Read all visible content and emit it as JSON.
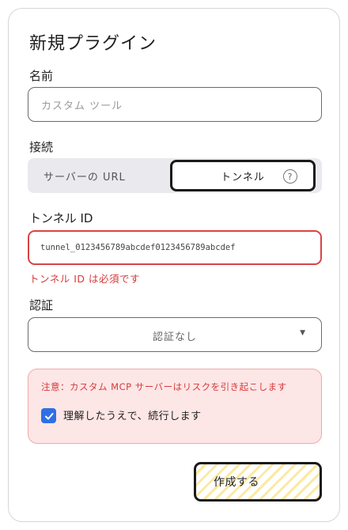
{
  "dialog": {
    "title": "新規プラグイン"
  },
  "name_field": {
    "label": "名前",
    "placeholder": "カスタム ツール"
  },
  "connection": {
    "label": "接続",
    "options": [
      "サーバーの URL",
      "トンネル"
    ],
    "selected": "トンネル",
    "help_icon": "question-circle-icon"
  },
  "tunnel_id": {
    "label": "トンネル ID",
    "value": "tunnel_0123456789abcdef0123456789abcdef",
    "error": "トンネル ID は必須です"
  },
  "auth": {
    "label": "認証",
    "value": "認証なし",
    "chevron_icon": "chevron-down-icon"
  },
  "warning": {
    "text": "注意：カスタム MCP サーバーはリスクを引き起こします",
    "checkbox_label": "理解したうえで、続行します",
    "checked": true
  },
  "actions": {
    "create_label": "作成する"
  },
  "colors": {
    "error": "#d63a3a",
    "warning_bg": "#fde6e6",
    "checkbox": "#2f6fe6",
    "button_stripe": "#fbe9a3"
  }
}
